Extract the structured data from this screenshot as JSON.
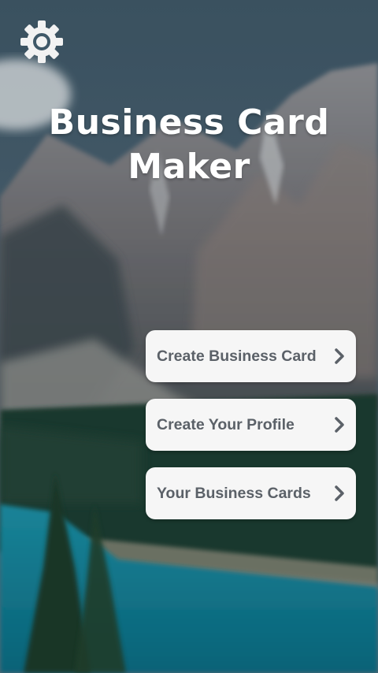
{
  "app": {
    "title_line1": "Business Card",
    "title_line2": "Maker"
  },
  "icons": {
    "settings": "gear-icon",
    "chevron": "chevron-right-icon"
  },
  "menu": [
    {
      "label": "Create Business Card"
    },
    {
      "label": "Create Your Profile"
    },
    {
      "label": "Your Business Cards"
    }
  ],
  "colors": {
    "button_bg": "#f6f6f6",
    "button_text": "#5b6168",
    "title_text": "#ffffff"
  }
}
